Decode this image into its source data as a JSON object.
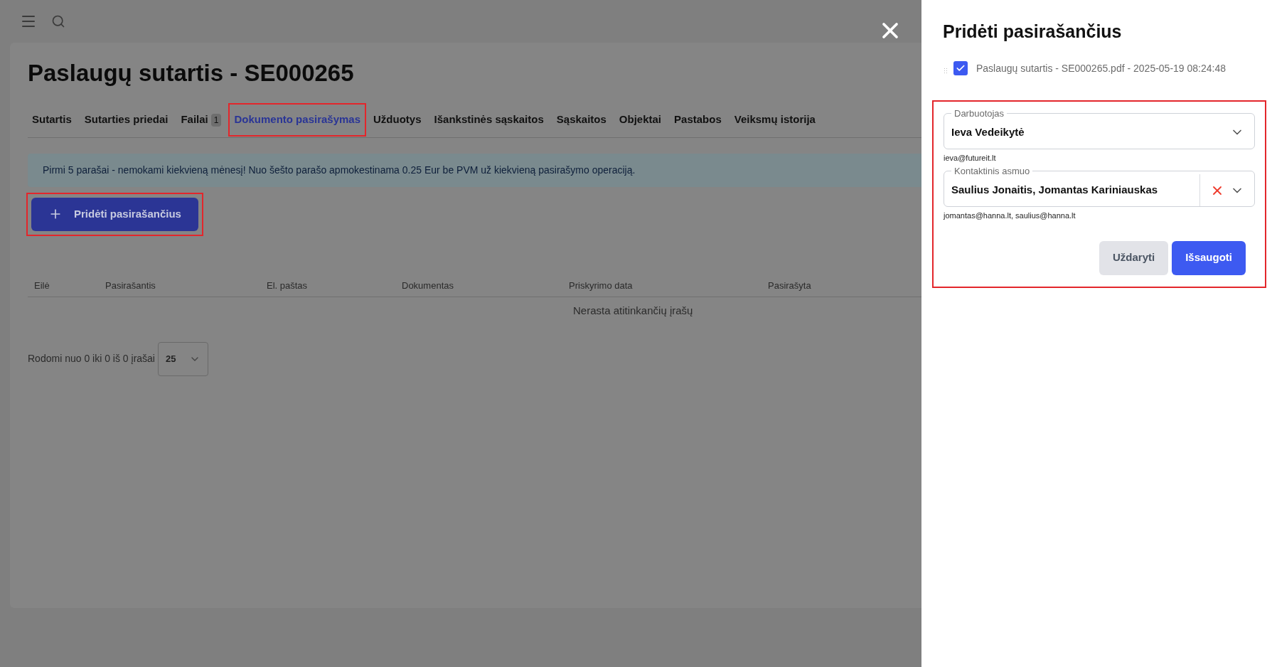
{
  "page": {
    "title": "Paslaugų sutartis - SE000265",
    "tabs": [
      {
        "label": "Sutartis",
        "selected": false,
        "highlighted": false
      },
      {
        "label": "Sutarties priedai",
        "selected": false,
        "highlighted": false
      },
      {
        "label": "Failai",
        "badge": "1",
        "selected": false,
        "highlighted": false
      },
      {
        "label": "Dokumento pasirašymas",
        "selected": true,
        "highlighted": true
      },
      {
        "label": "Užduotys",
        "selected": false,
        "highlighted": false
      },
      {
        "label": "Išankstinės sąskaitos",
        "selected": false,
        "highlighted": false
      },
      {
        "label": "Sąskaitos",
        "selected": false,
        "highlighted": false
      },
      {
        "label": "Objektai",
        "selected": false,
        "highlighted": false
      },
      {
        "label": "Pastabos",
        "selected": false,
        "highlighted": false
      },
      {
        "label": "Veiksmų istorija",
        "selected": false,
        "highlighted": false
      }
    ],
    "notice": "Pirmi 5 parašai - nemokami kiekvieną mėnesį! Nuo šešto parašo apmokestinama 0.25 Eur be PVM už kiekvieną pasirašymo operaciją.",
    "add_button": {
      "label": "Pridėti pasirašančius",
      "highlighted": true
    },
    "table": {
      "columns": [
        "Eilė",
        "Pasirašantis",
        "El. paštas",
        "Dokumentas",
        "Priskyrimo data",
        "Pasirašyta"
      ],
      "empty_message": "Nerasta atitinkančių įrašų"
    },
    "pagination": {
      "summary": "Rodomi nuo 0 iki 0 iš 0 įrašai",
      "page_size": "25"
    }
  },
  "dialog": {
    "title": "Pridėti pasirašančius",
    "document": {
      "label": "Paslaugų sutartis - SE000265.pdf - 2025-05-19 08:24:48",
      "checked": true
    },
    "form_highlighted": true,
    "fields": [
      {
        "label": "Darbuotojas",
        "value": "Ieva Vedeikytė",
        "clearable": false,
        "hint": "ieva@futureit.lt"
      },
      {
        "label": "Kontaktinis asmuo",
        "value": "Saulius Jonaitis, Jomantas Kariniauskas",
        "clearable": true,
        "hint": "jomantas@hanna.lt, saulius@hanna.lt"
      }
    ],
    "buttons": [
      {
        "label": "Uždaryti",
        "kind": "secondary"
      },
      {
        "label": "Išsaugoti",
        "kind": "primary"
      }
    ]
  }
}
